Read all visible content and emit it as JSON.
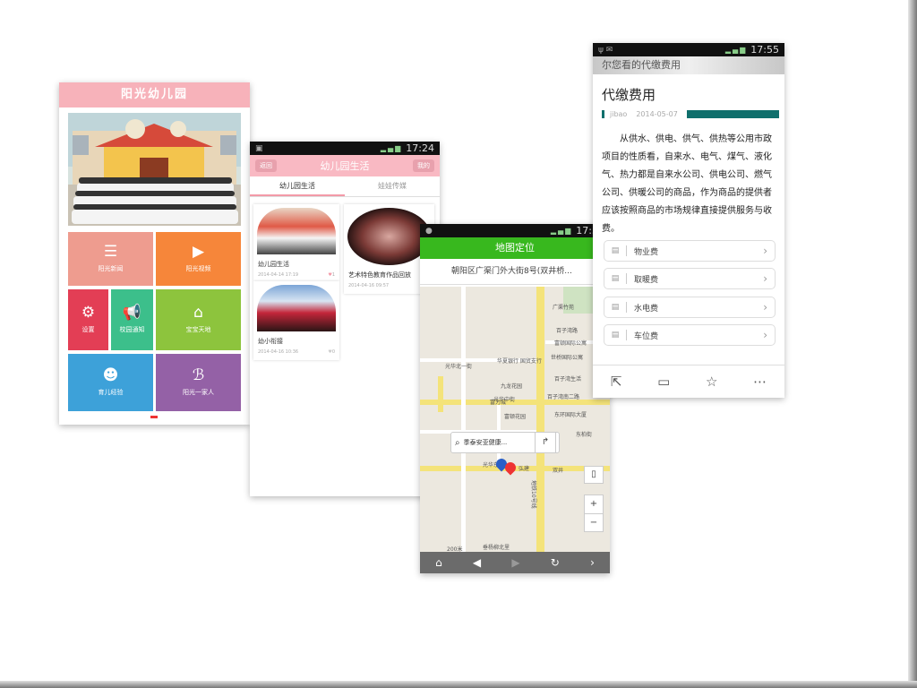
{
  "s1": {
    "title": "阳光幼儿园",
    "tiles": [
      {
        "label": "阳光新闻",
        "icon": "☰",
        "color": "#ee9c8f"
      },
      {
        "label": "阳光视频",
        "icon": "▶",
        "color": "#f6863a"
      },
      {
        "label": "设置",
        "icon": "⚙",
        "color": "#e33e55"
      },
      {
        "label": "校园通知",
        "icon": "📢",
        "color": "#3cbf8b"
      },
      {
        "label": "宝宝天地",
        "icon": "⌂",
        "color": "#8dc43d"
      },
      {
        "label": "育儿经验",
        "icon": "☻",
        "color": "#3da1d9"
      },
      {
        "label": "阳光一家人",
        "icon": "ℬ",
        "color": "#9461a6"
      }
    ]
  },
  "s2": {
    "time": "17:24",
    "back": "返回",
    "title": "幼儿园生活",
    "mine": "我的",
    "tabs": [
      "幼儿园生活",
      "娃娃传媒"
    ],
    "posts": [
      {
        "title": "幼儿园生活",
        "date": "2014-04-14 17:19",
        "likes": "1"
      },
      {
        "title": "艺术特色教育作品回放",
        "date": "2014-04-16 09:57",
        "likes": "1"
      },
      {
        "title": "幼小衔接",
        "date": "2014-04-16 10:36",
        "likes": "0"
      }
    ]
  },
  "s3": {
    "time": "17:35",
    "title": "地图定位",
    "address": "朝阳区广渠门外大街8号(双井桥...",
    "search": "季泰安亚健康...",
    "labels": [
      "广渠竹苑",
      "百子湾路",
      "富顿国际公寓",
      "华夏银行 国贸支行",
      "世桥国际公寓",
      "九龙花园",
      "富顿花园",
      "光华北一街",
      "百子湾南二路",
      "东环国际大厦",
      "光华东路",
      "东柏街",
      "双井",
      "垂杨柳北里",
      "富力城",
      "弘建",
      "地铁10号线",
      "光华中街",
      "百子湾生活"
    ],
    "scale": "200米",
    "zoom_in": "+",
    "zoom_out": "−"
  },
  "s4": {
    "time": "17:55",
    "banner": "尔您看的代缴费用",
    "heading": "代缴费用",
    "author": "jibao",
    "date": "2014-05-07",
    "body": "从供水、供电、供气、供热等公用市政项目的性质看，自来水、电气、煤气、液化气、热力都是自来水公司、供电公司、燃气公司、供暖公司的商品，作为商品的提供者应该按照商品的市场规律直接提供服务与收费。",
    "rows": [
      "物业费",
      "取暖费",
      "水电费",
      "车位费"
    ]
  }
}
